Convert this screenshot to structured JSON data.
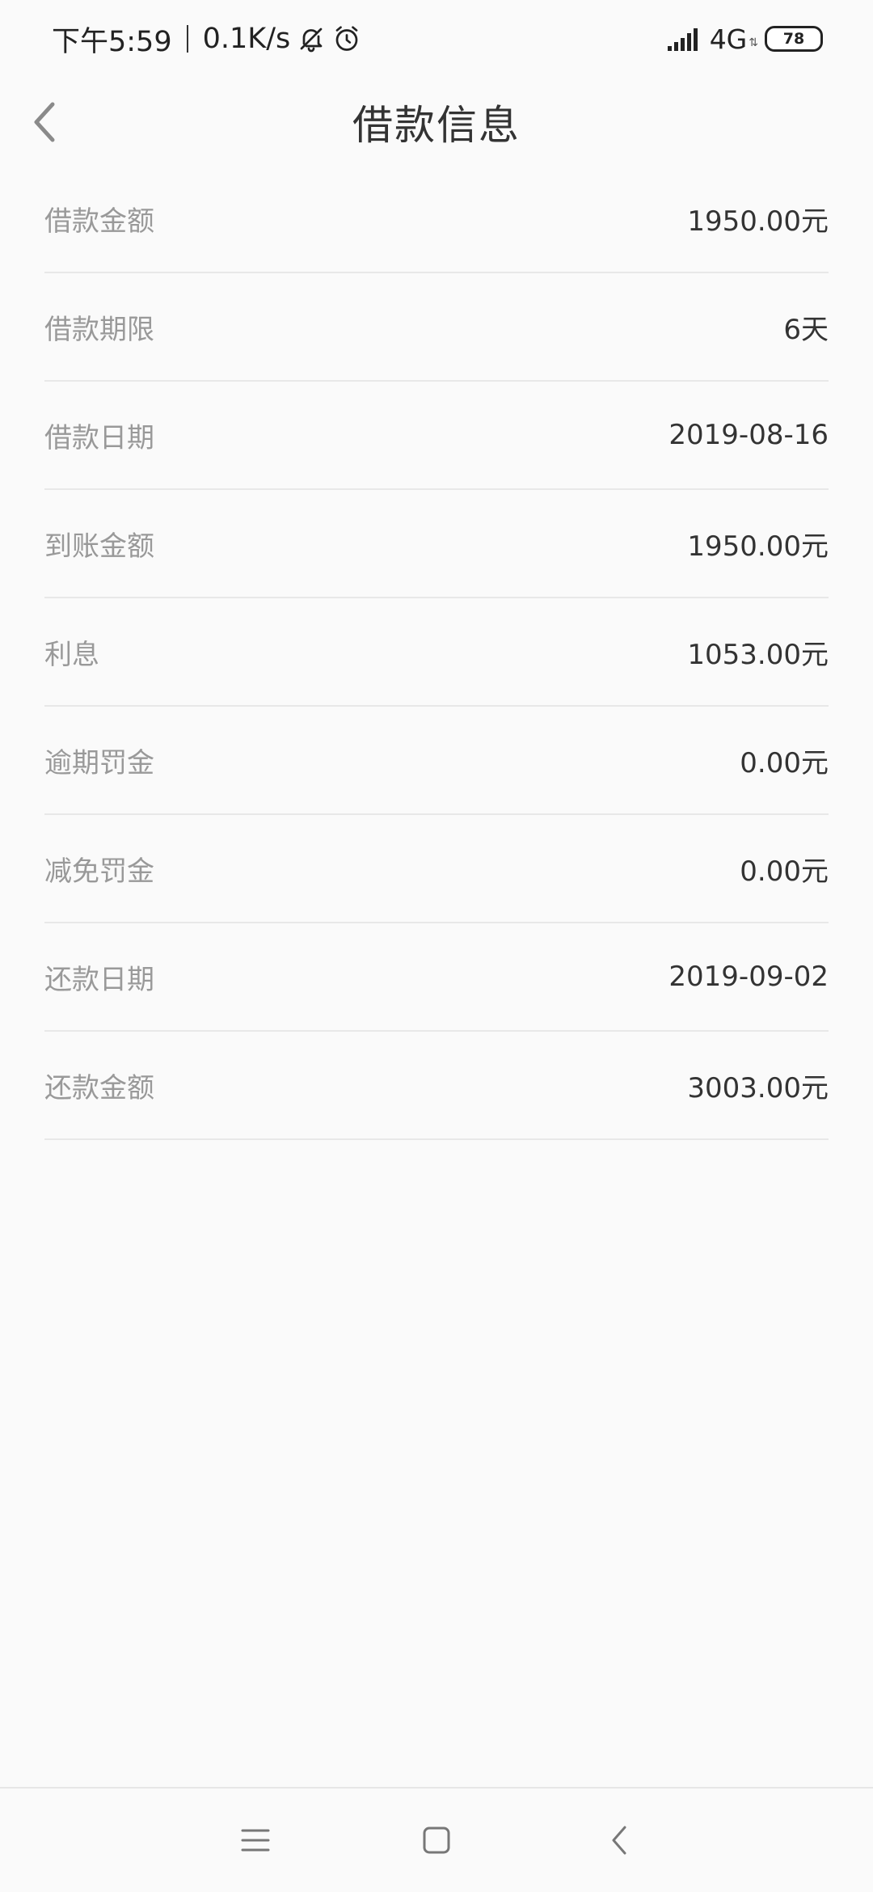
{
  "status_bar": {
    "time": "下午5:59",
    "speed": "0.1K/s",
    "network": "4G",
    "battery": "78",
    "icons": [
      "bell-muted-icon",
      "alarm-icon",
      "signal-icon",
      "battery-icon"
    ]
  },
  "header": {
    "title": "借款信息",
    "back_icon": "chevron-left-icon"
  },
  "loan_info": {
    "rows": [
      {
        "label": "借款金额",
        "value": "1950.00元"
      },
      {
        "label": "借款期限",
        "value": "6天"
      },
      {
        "label": "借款日期",
        "value": "2019-08-16"
      },
      {
        "label": "到账金额",
        "value": "1950.00元"
      },
      {
        "label": "利息",
        "value": "1053.00元"
      },
      {
        "label": "逾期罚金",
        "value": "0.00元"
      },
      {
        "label": "减免罚金",
        "value": "0.00元"
      },
      {
        "label": "还款日期",
        "value": "2019-09-02"
      },
      {
        "label": "还款金额",
        "value": "3003.00元"
      }
    ]
  },
  "nav_bar": {
    "icons": [
      "menu-icon",
      "home-icon",
      "back-icon"
    ]
  },
  "colors": {
    "background": "#fafafa",
    "label": "#999999",
    "value": "#333333",
    "divider": "#e8e8e8"
  }
}
